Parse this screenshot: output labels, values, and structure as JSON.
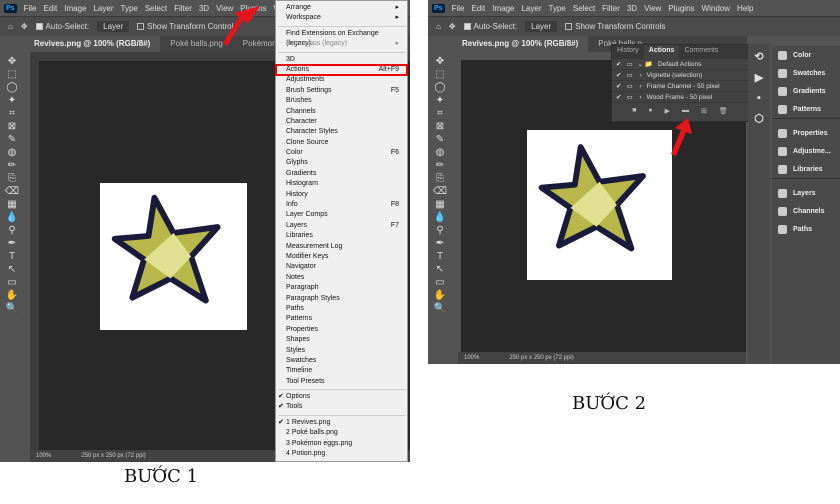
{
  "menubar": [
    "File",
    "Edit",
    "Image",
    "Layer",
    "Type",
    "Select",
    "Filter",
    "3D",
    "View",
    "Plugins",
    "Window"
  ],
  "menubar2": [
    "File",
    "Edit",
    "Image",
    "Layer",
    "Type",
    "Select",
    "Filter",
    "3D",
    "View",
    "Plugins",
    "Window",
    "Help"
  ],
  "options": {
    "auto_select": "Auto-Select:",
    "layer": "Layer",
    "transform": "Show Transform Controls"
  },
  "tabs1": [
    "Revives.png @ 100% (RGB/8#)",
    "Poké balls.png",
    "Pokémon eggs.png"
  ],
  "tabs2": [
    "Revives.png @ 100% (RGB/8#)",
    "Poké balls.p"
  ],
  "status": {
    "zoom": "100%",
    "size": "250 px x 250 px (72 ppi)"
  },
  "window_menu": {
    "group1": [
      {
        "label": "Arrange",
        "sub": "▸"
      },
      {
        "label": "Workspace",
        "sub": "▸"
      }
    ],
    "group2": [
      {
        "label": "Find Extensions on Exchange (legacy)..."
      },
      {
        "label": "Extensions (legacy)",
        "sub": "▸",
        "disabled": true
      }
    ],
    "group3": [
      {
        "label": "3D"
      },
      {
        "label": "Actions",
        "shortcut": "Alt+F9",
        "highlight": true
      },
      {
        "label": "Adjustments"
      },
      {
        "label": "Brush Settings",
        "shortcut": "F5"
      },
      {
        "label": "Brushes"
      },
      {
        "label": "Channels"
      },
      {
        "label": "Character"
      },
      {
        "label": "Character Styles"
      },
      {
        "label": "Clone Source"
      },
      {
        "label": "Color",
        "shortcut": "F6"
      },
      {
        "label": "Glyphs"
      },
      {
        "label": "Gradients"
      },
      {
        "label": "Histogram"
      },
      {
        "label": "History"
      },
      {
        "label": "Info",
        "shortcut": "F8"
      },
      {
        "label": "Layer Comps"
      },
      {
        "label": "Layers",
        "shortcut": "F7"
      },
      {
        "label": "Libraries"
      },
      {
        "label": "Measurement Log"
      },
      {
        "label": "Modifier Keys"
      },
      {
        "label": "Navigator"
      },
      {
        "label": "Notes"
      },
      {
        "label": "Paragraph"
      },
      {
        "label": "Paragraph Styles"
      },
      {
        "label": "Paths"
      },
      {
        "label": "Patterns"
      },
      {
        "label": "Properties"
      },
      {
        "label": "Shapes"
      },
      {
        "label": "Styles"
      },
      {
        "label": "Swatches"
      },
      {
        "label": "Timeline"
      },
      {
        "label": "Tool Presets"
      }
    ],
    "group4": [
      {
        "label": "Options",
        "checked": true
      },
      {
        "label": "Tools",
        "checked": true
      }
    ],
    "group5": [
      {
        "label": "1 Revives.png",
        "checked": true
      },
      {
        "label": "2 Poké balls.png"
      },
      {
        "label": "3 Pokémon eggs.png"
      },
      {
        "label": "4 Potion.png"
      }
    ]
  },
  "actions_panel": {
    "tabs": [
      "History",
      "Actions",
      "Comments"
    ],
    "rows": [
      "Default Actions",
      "Vignette (selection)",
      "Frame Channel - 50 pixel",
      "Wood Frame - 50 pixel"
    ]
  },
  "right_panels": [
    [
      "Color",
      "Swatches",
      "Gradients",
      "Patterns"
    ],
    [
      "Properties",
      "Adjustme...",
      "Libraries"
    ],
    [
      "Layers",
      "Channels",
      "Paths"
    ]
  ],
  "captions": [
    "BƯỚC 1",
    "BƯỚC 2"
  ],
  "colors": {
    "highlight": "#e00000",
    "arrow": "#e8141b",
    "star": "#b8b84a"
  }
}
